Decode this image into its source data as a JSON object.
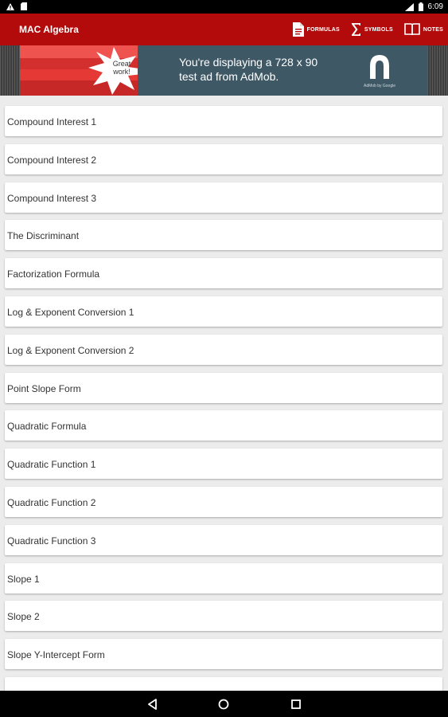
{
  "status_bar": {
    "time": "6:09"
  },
  "app_bar": {
    "title": "MAC Algebra",
    "actions": [
      {
        "label": "FORMULAS",
        "icon": "document-icon"
      },
      {
        "label": "SYMBOLS",
        "icon": "sigma-icon"
      },
      {
        "label": "NOTES",
        "icon": "book-icon"
      }
    ]
  },
  "ad": {
    "badge_text": "Great work!",
    "line1": "You're displaying a 728 x 90",
    "line2": "test ad from AdMob.",
    "brand": "AdMob by Google"
  },
  "list": {
    "items": [
      "Compound Interest 1",
      "Compound Interest 2",
      "Compound Interest 3",
      "The Discriminant",
      "Factorization Formula",
      "Log & Exponent Conversion 1",
      "Log & Exponent Conversion 2",
      "Point Slope Form",
      "Quadratic Formula",
      "Quadratic Function 1",
      "Quadratic Function 2",
      "Quadratic Function 3",
      "Slope 1",
      "Slope 2",
      "Slope Y-Intercept Form"
    ]
  },
  "colors": {
    "app_bar": "#b30b0b",
    "ad_background": "#3e5866",
    "list_background": "#ececec"
  }
}
